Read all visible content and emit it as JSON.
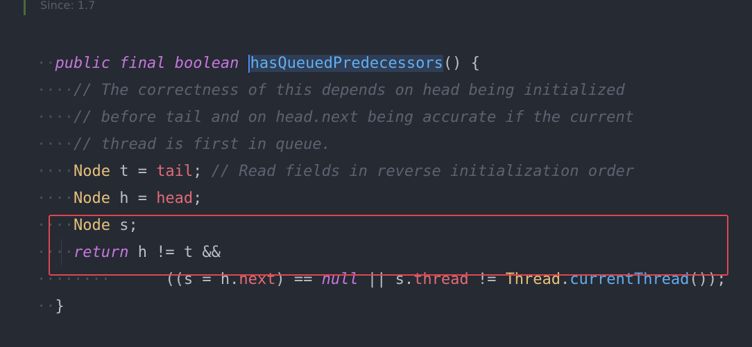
{
  "doc_fade": "Since:     1.7",
  "ws_l2": "····",
  "ws_l6": "····",
  "ws_l9": "········",
  "lines": {
    "l1": {
      "kw1": "public",
      "kw2": "final",
      "kw3": "boolean",
      "method": "hasQueuedPredecessors",
      "rest": "() {"
    },
    "l2": {
      "comment": "// The correctness of this depends on head being initialized"
    },
    "l3": {
      "comment": "// before tail and on head.next being accurate if the current"
    },
    "l4": {
      "comment": "// thread is first in queue."
    },
    "l5": {
      "type": "Node",
      "var": " t = ",
      "field": "tail",
      "semi": ";",
      "comment": " // Read fields in reverse initialization order"
    },
    "l6": {
      "type": "Node",
      "var": " h = ",
      "field": "head",
      "semi": ";"
    },
    "l7": {
      "type": "Node",
      "var": " s;"
    },
    "l8": {
      "kw": "return",
      "rest": " h != t &&"
    },
    "l9": {
      "p1": "((s = h.",
      "field1": "next",
      "p2": ") == ",
      "kw": "null",
      "p3": " || s.",
      "field2": "thread",
      "p4": " != ",
      "type": "Thread",
      "dot": ".",
      "method": "currentThread",
      "p5": "());"
    },
    "l10": {
      "brace": "}"
    }
  }
}
